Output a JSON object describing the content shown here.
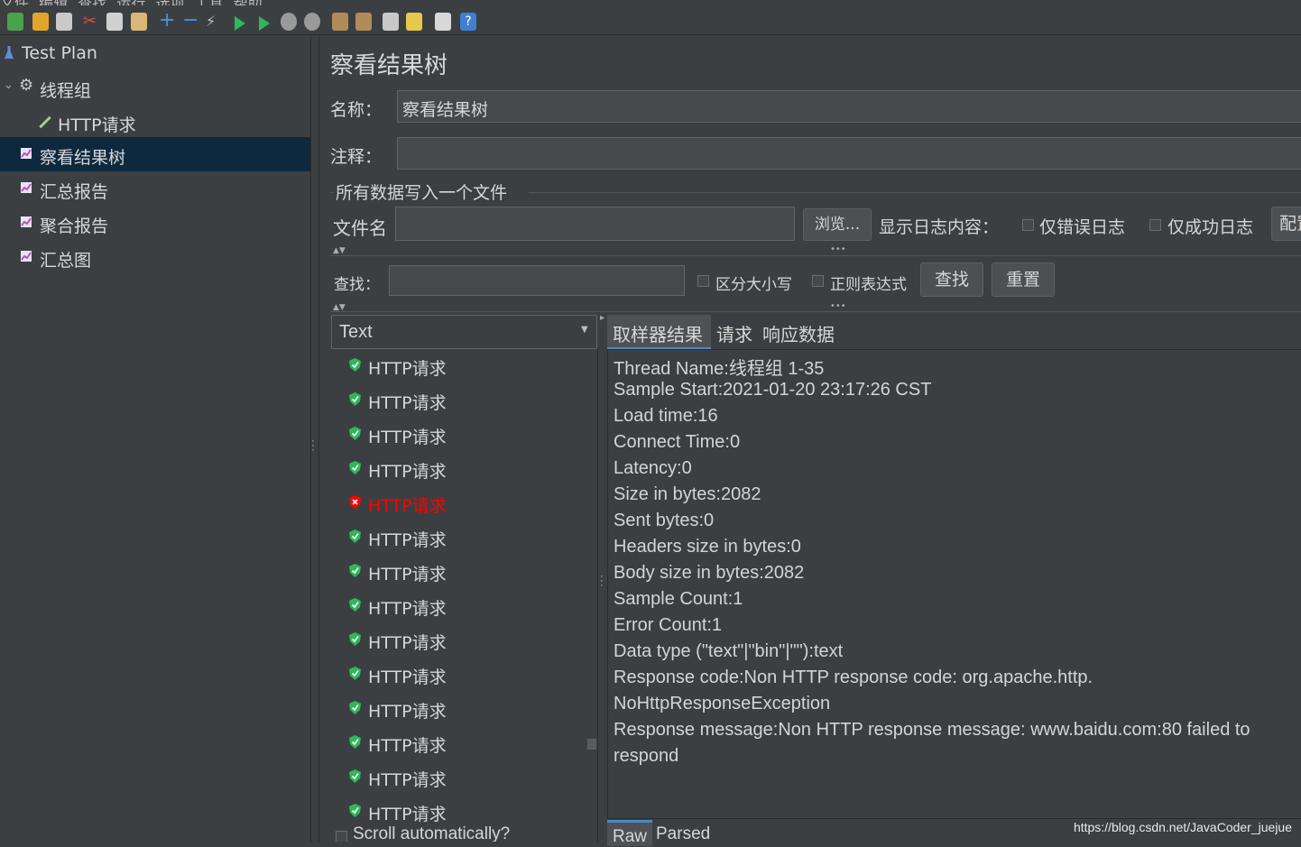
{
  "menu": [
    "文件",
    "编辑",
    "查找",
    "运行",
    "选项",
    "工具",
    "帮助"
  ],
  "tree": [
    {
      "label": "Test Plan",
      "icon": "flask-icon"
    },
    {
      "label": "线程组",
      "icon": "gear-icon"
    },
    {
      "label": "HTTP请求",
      "icon": "pipette-icon"
    },
    {
      "label": "察看结果树",
      "icon": "chart-icon"
    },
    {
      "label": "汇总报告",
      "icon": "chart-icon"
    },
    {
      "label": "聚合报告",
      "icon": "chart-icon"
    },
    {
      "label": "汇总图",
      "icon": "chart-icon"
    }
  ],
  "panel": {
    "title": "察看结果树",
    "name_label": "名称：",
    "name_value": "察看结果树",
    "comment_label": "注释：",
    "comment_value": "",
    "file_group_title": "所有数据写入一个文件",
    "filename_label": "文件名",
    "filename_value": "",
    "browse_button": "浏览...",
    "log_label": "显示日志内容：",
    "errors_only": "仅错误日志",
    "success_only": "仅成功日志",
    "configure_button": "配置",
    "search_label": "查找：",
    "search_value": "",
    "case_sensitive": "区分大小写",
    "regex": "正则表达式",
    "find_button": "查找",
    "reset_button": "重置"
  },
  "renderer": {
    "selected": "Text"
  },
  "samples": [
    {
      "label": "HTTP请求",
      "status": "success"
    },
    {
      "label": "HTTP请求",
      "status": "success"
    },
    {
      "label": "HTTP请求",
      "status": "success"
    },
    {
      "label": "HTTP请求",
      "status": "success"
    },
    {
      "label": "HTTP请求",
      "status": "error"
    },
    {
      "label": "HTTP请求",
      "status": "success"
    },
    {
      "label": "HTTP请求",
      "status": "success"
    },
    {
      "label": "HTTP请求",
      "status": "success"
    },
    {
      "label": "HTTP请求",
      "status": "success"
    },
    {
      "label": "HTTP请求",
      "status": "success"
    },
    {
      "label": "HTTP请求",
      "status": "success"
    },
    {
      "label": "HTTP请求",
      "status": "success"
    },
    {
      "label": "HTTP请求",
      "status": "success"
    },
    {
      "label": "HTTP请求",
      "status": "success"
    }
  ],
  "scroll_auto": "Scroll automatically?",
  "tabs": [
    "取样器结果",
    "请求",
    "响应数据"
  ],
  "details": [
    "Thread Name:线程组 1-35",
    "Sample Start:2021-01-20 23:17:26 CST",
    "Load time:16",
    "Connect Time:0",
    "Latency:0",
    "Size in bytes:2082",
    "Sent bytes:0",
    "Headers size in bytes:0",
    "Body size in bytes:2082",
    "Sample Count:1",
    "Error Count:1",
    "Data type (\"text\"|\"bin\"|\"\"):text",
    "Response code:Non HTTP response code: org.apache.http.",
    "NoHttpResponseException",
    "Response message:Non HTTP response message: www.baidu.com:80 failed to",
    "respond"
  ],
  "bottom_tabs": [
    "Raw",
    "Parsed"
  ],
  "watermark": "https://blog.csdn.net/JavaCoder_juejue",
  "colors": {
    "selection": "#0d293e",
    "error": "#ff0000",
    "success": "#2fb85b",
    "tab_active": "#4e5254"
  }
}
